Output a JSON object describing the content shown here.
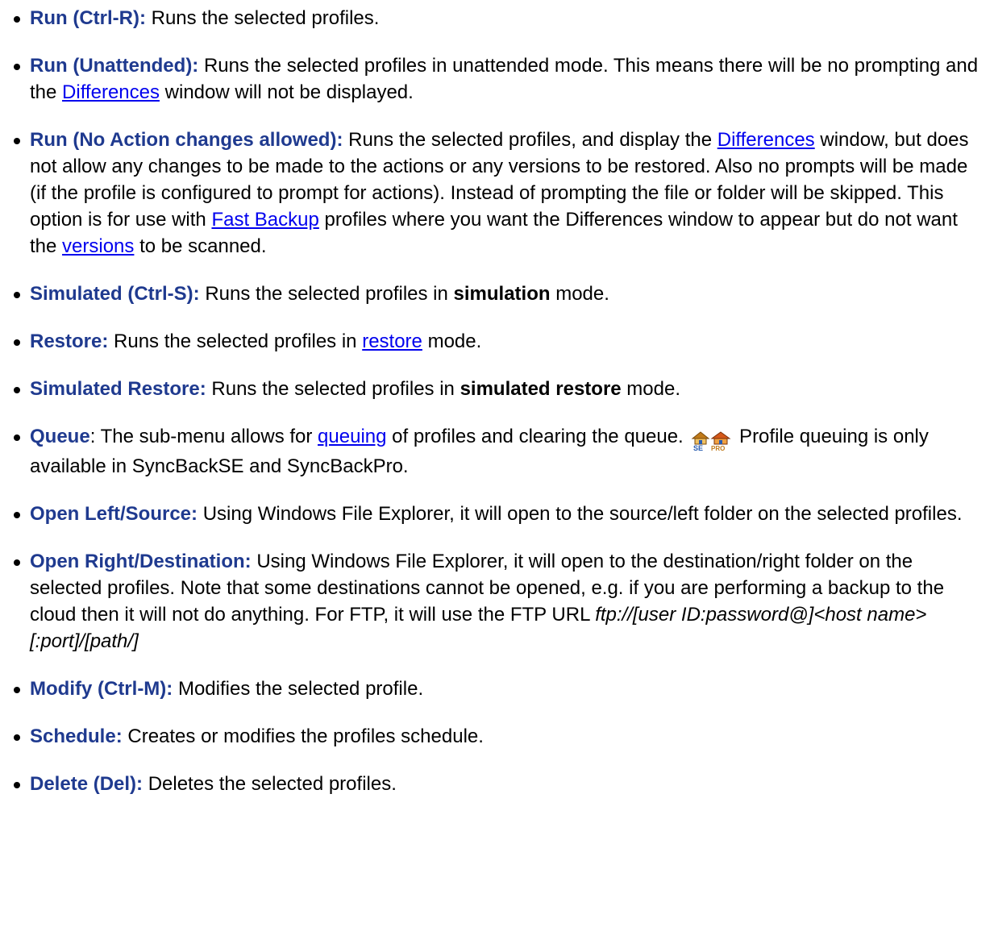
{
  "items": {
    "run": {
      "term": "Run (Ctrl-R):",
      "text": " Runs the selected profiles."
    },
    "run_unattended": {
      "term": "Run (Unattended):",
      "text1": " Runs the selected profiles in unattended mode. This means there will be no prompting and the ",
      "link1": "Differences",
      "text2": " window will not be displayed."
    },
    "run_no_action": {
      "term": "Run (No Action changes allowed):",
      "text1": " Runs the selected profiles, and display the ",
      "link1": "Differences",
      "text2": " window, but does not allow any changes to be made to the actions or any versions to be restored. Also no prompts will be made (if the profile is configured to prompt for actions). Instead of prompting the file or folder will be skipped. This option is for use with ",
      "link2": "Fast Backup",
      "text3": " profiles where you want the Differences window to appear but do not want the ",
      "link3": "versions",
      "text4": " to be scanned."
    },
    "simulated": {
      "term": "Simulated (Ctrl-S):",
      "text1": " Runs the selected profiles in ",
      "bold": "simulation",
      "text2": " mode."
    },
    "restore": {
      "term": "Restore:",
      "text1": " Runs the selected profiles in ",
      "link1": "restore",
      "text2": " mode."
    },
    "simulated_restore": {
      "term": "Simulated Restore:",
      "text1": " Runs the selected profiles in ",
      "bold": "simulated restore",
      "text2": " mode."
    },
    "queue": {
      "term": "Queue",
      "text1": ": The sub-menu allows for ",
      "link1": "queuing",
      "text2": " of profiles and clearing the queue. ",
      "icon_se": "syncback-se-icon",
      "icon_pro": "syncback-pro-icon",
      "text3": " Profile queuing is only available in SyncBackSE and SyncBackPro."
    },
    "open_left": {
      "term": "Open Left/Source:",
      "text": " Using Windows File Explorer, it will open to the source/left folder on the selected profiles."
    },
    "open_right": {
      "term": "Open Right/Destination:",
      "text1": " Using Windows File Explorer, it will open to the destination/right folder on the selected profiles. Note that some destinations cannot be opened, e.g. if you are performing a backup to the cloud then it will not do anything. For FTP, it will use the FTP URL ",
      "italic": "ftp://[user ID:password@]<host name>[:port]/[path/]"
    },
    "modify": {
      "term": "Modify (Ctrl-M):",
      "text": " Modifies the selected profile."
    },
    "schedule": {
      "term": "Schedule:",
      "text": " Creates or modifies the profiles schedule."
    },
    "delete": {
      "term": "Delete (Del):",
      "text": " Deletes the selected profiles."
    }
  },
  "colors": {
    "term": "#1f3a8f",
    "link": "#0000ee",
    "text": "#000000"
  }
}
